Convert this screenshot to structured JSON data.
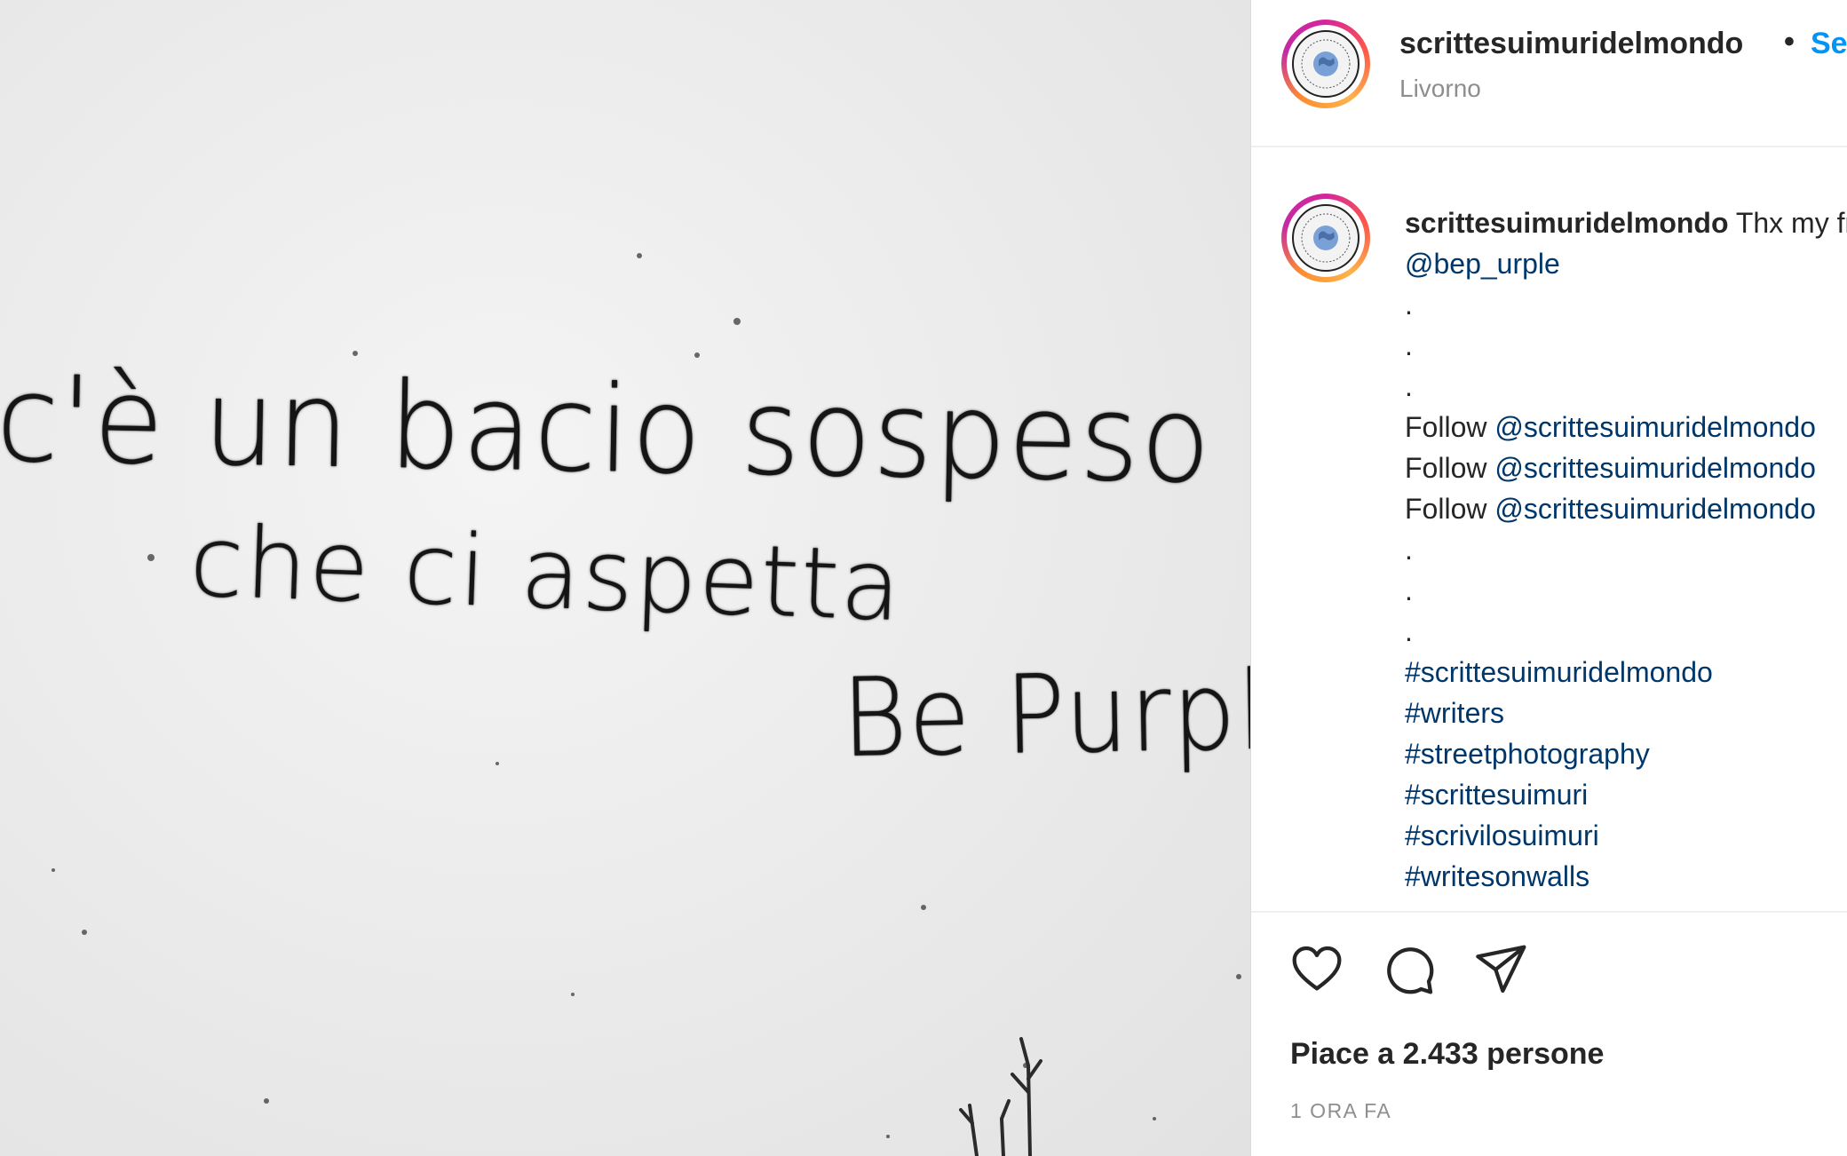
{
  "photo": {
    "graffiti_lines": [
      "c'è un bacio sospeso",
      "che ci aspetta",
      "Be Purple"
    ]
  },
  "header": {
    "username": "scrittesuimuridelmondo",
    "separator": "•",
    "follow_label": "Segui",
    "location": "Livorno"
  },
  "avatar": {
    "logo_text": "@scrittesuimuridelmondo"
  },
  "caption": {
    "username": "scrittesuimuridelmondo",
    "lines": [
      {
        "prefix": "",
        "text": " Thx my friend"
      },
      {
        "prefix": "",
        "mention": "@bep_urple"
      },
      {
        "prefix": ".",
        "mention": ""
      },
      {
        "prefix": ".",
        "mention": ""
      },
      {
        "prefix": ".",
        "mention": ""
      },
      {
        "prefix": "Follow ",
        "mention": "@scrittesuimuridelmondo"
      },
      {
        "prefix": "Follow ",
        "mention": "@scrittesuimuridelmondo"
      },
      {
        "prefix": "Follow ",
        "mention": "@scrittesuimuridelmondo"
      },
      {
        "prefix": ".",
        "mention": ""
      },
      {
        "prefix": ".",
        "mention": ""
      },
      {
        "prefix": ".",
        "mention": ""
      }
    ],
    "hashtags": [
      "#scrittesuimuridelmondo",
      "#writers",
      "#streetphotography",
      "#scrittesuimuri",
      "#scrivilosuimuri",
      "#writesonwalls"
    ]
  },
  "actions": {
    "like_icon": "heart-icon",
    "comment_icon": "comment-icon",
    "share_icon": "send-icon"
  },
  "likes_text": "Piace a 2.433 persone",
  "timestamp": "1 ORA FA",
  "colors": {
    "link": "#00376b",
    "follow": "#0095f6",
    "text": "#262626",
    "muted": "#8e8e8e"
  }
}
